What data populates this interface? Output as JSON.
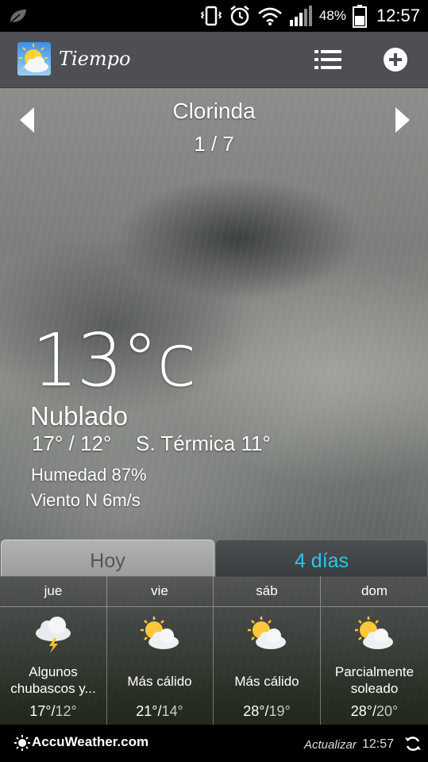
{
  "status_bar": {
    "battery_percent": "48%",
    "time": "12:57",
    "icons": [
      "leaf-icon",
      "vibrate-icon",
      "alarm-icon",
      "wifi-icon",
      "signal-icon",
      "battery-icon"
    ]
  },
  "action_bar": {
    "title": "Tiempo",
    "icons": [
      "app-sun-cloud-icon",
      "list-icon",
      "add-icon"
    ]
  },
  "location": {
    "city": "Clorinda",
    "pager": "1 / 7",
    "prev_icon": "chevron-left-icon",
    "next_icon": "chevron-right-icon"
  },
  "current": {
    "temperature": "13°c",
    "condition": "Nublado",
    "minmax": "17° / 12°",
    "feels_like": "S. Térmica 11°",
    "humidity": "Humedad 87%",
    "wind": "Viento N 6m/s"
  },
  "tabs": {
    "today": "Hoy",
    "four_days": "4 días",
    "active": "four_days",
    "active_color": "#27c9e8"
  },
  "forecast": [
    {
      "day": "jue",
      "icon": "thunderstorm-cloud-icon",
      "text_lines": [
        "Algunos",
        "chubascos y..."
      ],
      "high": "17°",
      "low": "12°"
    },
    {
      "day": "vie",
      "icon": "partly-sunny-icon",
      "text_lines": [
        "Más cálido"
      ],
      "high": "21°",
      "low": "14°"
    },
    {
      "day": "sáb",
      "icon": "partly-sunny-icon",
      "text_lines": [
        "Más cálido"
      ],
      "high": "28°",
      "low": "19°"
    },
    {
      "day": "dom",
      "icon": "partly-sunny-icon",
      "text_lines": [
        "Parcialmente",
        "soleado"
      ],
      "high": "28°",
      "low": "20°"
    }
  ],
  "footer": {
    "brand": "AccuWeather.com",
    "update_label": "Actualizar",
    "update_time": "12:57",
    "refresh_icon": "refresh-icon"
  }
}
